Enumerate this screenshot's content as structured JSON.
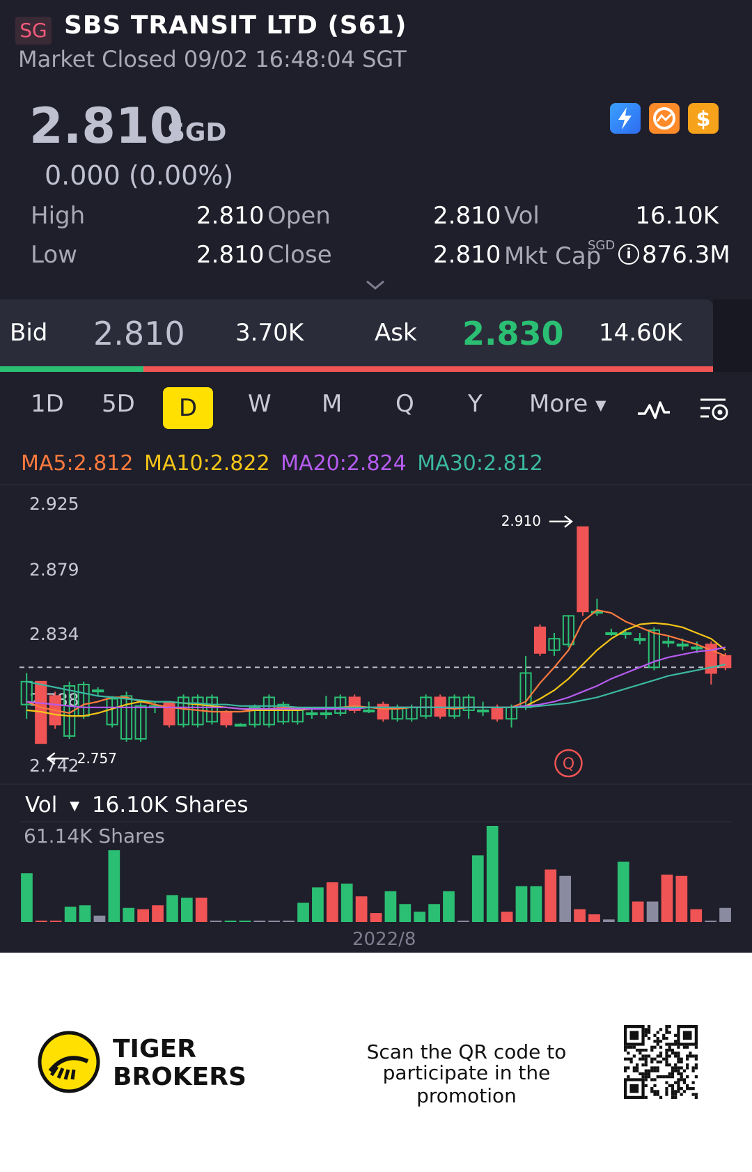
{
  "header": {
    "market_tag": "SG",
    "title": "SBS TRANSIT LTD (S61)",
    "status": "Market Closed 09/02 16:48:04 SGT"
  },
  "quote": {
    "price": "2.810",
    "currency": "SGD",
    "change": "0.000 (0.00%)",
    "stats": {
      "high_label": "High",
      "high_value": "2.810",
      "low_label": "Low",
      "low_value": "2.810",
      "open_label": "Open",
      "open_value": "2.810",
      "close_label": "Close",
      "close_value": "2.810",
      "vol_label": "Vol",
      "vol_value": "16.10K",
      "mktcap_label": "Mkt Cap",
      "mktcap_currency": "SGD",
      "mktcap_value": "876.3M"
    }
  },
  "orderbook": {
    "bid_label": "Bid",
    "bid_price": "2.810",
    "bid_size": "3.70K",
    "ask_label": "Ask",
    "ask_price": "2.830",
    "ask_size": "14.60K"
  },
  "timeframes": [
    "1D",
    "5D",
    "D",
    "W",
    "M",
    "Q",
    "Y"
  ],
  "selected_timeframe": "D",
  "more_label": "More",
  "icons": {
    "indicator": "line-indicator-icon",
    "settings": "chart-settings-icon",
    "badges": [
      "lightning-icon",
      "chart-badge-icon",
      "dollar-icon"
    ]
  },
  "ma": {
    "ma5": "MA5:2.812",
    "ma10": "MA10:2.822",
    "ma20": "MA20:2.824",
    "ma30": "MA30:2.812"
  },
  "colors": {
    "background": "#1f1f2b",
    "up": "#2bbf73",
    "down": "#f05454",
    "neutral": "#8a8aa0",
    "ma5": "#ff7a3d",
    "ma10": "#f5c518",
    "ma20": "#b65cf0",
    "ma30": "#3bb8a0",
    "selected_tab": "#ffe000"
  },
  "chart_data": {
    "type": "candlestick",
    "y_ticks": [
      "2.925",
      "2.879",
      "2.834",
      "2.788",
      "2.742"
    ],
    "ylim": [
      2.742,
      2.925
    ],
    "high_marker": "2.910",
    "low_marker": "2.757",
    "event_marker": "Q",
    "x_label": "2022/8",
    "candles": [
      {
        "o": 2.784,
        "c": 2.8,
        "h": 2.806,
        "l": 2.774
      },
      {
        "o": 2.8,
        "c": 2.757,
        "h": 2.8,
        "l": 2.757
      },
      {
        "o": 2.79,
        "c": 2.77,
        "h": 2.793,
        "l": 2.767
      },
      {
        "o": 2.762,
        "c": 2.797,
        "h": 2.8,
        "l": 2.76
      },
      {
        "o": 2.776,
        "c": 2.798,
        "h": 2.8,
        "l": 2.774
      },
      {
        "o": 2.794,
        "c": 2.794,
        "h": 2.796,
        "l": 2.79
      },
      {
        "o": 2.77,
        "c": 2.788,
        "h": 2.79,
        "l": 2.768
      },
      {
        "o": 2.76,
        "c": 2.79,
        "h": 2.793,
        "l": 2.758
      },
      {
        "o": 2.76,
        "c": 2.783,
        "h": 2.785,
        "l": 2.758
      },
      {
        "o": 2.783,
        "c": 2.783,
        "h": 2.786,
        "l": 2.778
      },
      {
        "o": 2.785,
        "c": 2.77,
        "h": 2.786,
        "l": 2.768
      },
      {
        "o": 2.77,
        "c": 2.789,
        "h": 2.791,
        "l": 2.768
      },
      {
        "o": 2.77,
        "c": 2.789,
        "h": 2.791,
        "l": 2.768
      },
      {
        "o": 2.772,
        "c": 2.789,
        "h": 2.791,
        "l": 2.77
      },
      {
        "o": 2.778,
        "c": 2.77,
        "h": 2.78,
        "l": 2.768
      },
      {
        "o": 2.77,
        "c": 2.77,
        "h": 2.771,
        "l": 2.769
      },
      {
        "o": 2.77,
        "c": 2.782,
        "h": 2.784,
        "l": 2.768
      },
      {
        "o": 2.77,
        "c": 2.789,
        "h": 2.791,
        "l": 2.768
      },
      {
        "o": 2.772,
        "c": 2.784,
        "h": 2.786,
        "l": 2.77
      },
      {
        "o": 2.772,
        "c": 2.78,
        "h": 2.782,
        "l": 2.77
      },
      {
        "o": 2.778,
        "c": 2.778,
        "h": 2.781,
        "l": 2.774
      },
      {
        "o": 2.778,
        "c": 2.778,
        "h": 2.79,
        "l": 2.774
      },
      {
        "o": 2.778,
        "c": 2.789,
        "h": 2.791,
        "l": 2.776
      },
      {
        "o": 2.789,
        "c": 2.78,
        "h": 2.791,
        "l": 2.778
      },
      {
        "o": 2.78,
        "c": 2.78,
        "h": 2.786,
        "l": 2.778
      },
      {
        "o": 2.784,
        "c": 2.774,
        "h": 2.786,
        "l": 2.772
      },
      {
        "o": 2.774,
        "c": 2.782,
        "h": 2.784,
        "l": 2.772
      },
      {
        "o": 2.774,
        "c": 2.782,
        "h": 2.784,
        "l": 2.772
      },
      {
        "o": 2.776,
        "c": 2.789,
        "h": 2.791,
        "l": 2.774
      },
      {
        "o": 2.789,
        "c": 2.776,
        "h": 2.791,
        "l": 2.774
      },
      {
        "o": 2.776,
        "c": 2.789,
        "h": 2.791,
        "l": 2.774
      },
      {
        "o": 2.78,
        "c": 2.789,
        "h": 2.791,
        "l": 2.774
      },
      {
        "o": 2.78,
        "c": 2.78,
        "h": 2.786,
        "l": 2.776
      },
      {
        "o": 2.782,
        "c": 2.774,
        "h": 2.784,
        "l": 2.772
      },
      {
        "o": 2.774,
        "c": 2.782,
        "h": 2.784,
        "l": 2.768
      },
      {
        "o": 2.782,
        "c": 2.806,
        "h": 2.818,
        "l": 2.78
      },
      {
        "o": 2.838,
        "c": 2.82,
        "h": 2.84,
        "l": 2.818
      },
      {
        "o": 2.822,
        "c": 2.83,
        "h": 2.834,
        "l": 2.818
      },
      {
        "o": 2.826,
        "c": 2.846,
        "h": 2.846,
        "l": 2.824
      },
      {
        "o": 2.908,
        "c": 2.849,
        "h": 2.908,
        "l": 2.846
      },
      {
        "o": 2.849,
        "c": 2.849,
        "h": 2.858,
        "l": 2.846
      },
      {
        "o": 2.834,
        "c": 2.834,
        "h": 2.837,
        "l": 2.832
      },
      {
        "o": 2.834,
        "c": 2.834,
        "h": 2.837,
        "l": 2.83
      },
      {
        "o": 2.83,
        "c": 2.83,
        "h": 2.834,
        "l": 2.826
      },
      {
        "o": 2.81,
        "c": 2.836,
        "h": 2.838,
        "l": 2.808
      },
      {
        "o": 2.828,
        "c": 2.828,
        "h": 2.832,
        "l": 2.824
      },
      {
        "o": 2.826,
        "c": 2.826,
        "h": 2.83,
        "l": 2.822
      },
      {
        "o": 2.824,
        "c": 2.824,
        "h": 2.828,
        "l": 2.82
      },
      {
        "o": 2.826,
        "c": 2.806,
        "h": 2.828,
        "l": 2.798
      },
      {
        "o": 2.818,
        "c": 2.81,
        "h": 2.82,
        "l": 2.808
      }
    ],
    "ma5": [
      2.786,
      2.782,
      2.78,
      2.778,
      2.784,
      2.786,
      2.789,
      2.789,
      2.786,
      2.784,
      2.782,
      2.781,
      2.78,
      2.779,
      2.779,
      2.779,
      2.78,
      2.781,
      2.782,
      2.782,
      2.781,
      2.781,
      2.782,
      2.783,
      2.782,
      2.781,
      2.781,
      2.782,
      2.782,
      2.782,
      2.781,
      2.782,
      2.782,
      2.782,
      2.782,
      2.786,
      2.799,
      2.81,
      2.822,
      2.842,
      2.85,
      2.848,
      2.842,
      2.838,
      2.834,
      2.832,
      2.829,
      2.826,
      2.822,
      2.818
    ],
    "ma10": [
      2.78,
      2.779,
      2.777,
      2.776,
      2.776,
      2.778,
      2.781,
      2.784,
      2.786,
      2.786,
      2.786,
      2.785,
      2.784,
      2.783,
      2.782,
      2.781,
      2.78,
      2.78,
      2.78,
      2.78,
      2.781,
      2.781,
      2.781,
      2.782,
      2.782,
      2.782,
      2.782,
      2.782,
      2.782,
      2.782,
      2.782,
      2.782,
      2.782,
      2.782,
      2.782,
      2.783,
      2.788,
      2.794,
      2.802,
      2.812,
      2.822,
      2.83,
      2.836,
      2.84,
      2.841,
      2.84,
      2.838,
      2.834,
      2.83,
      2.822
    ],
    "ma20": [
      2.786,
      2.785,
      2.784,
      2.783,
      2.782,
      2.782,
      2.782,
      2.782,
      2.782,
      2.782,
      2.782,
      2.782,
      2.782,
      2.782,
      2.782,
      2.781,
      2.781,
      2.781,
      2.781,
      2.781,
      2.781,
      2.781,
      2.781,
      2.781,
      2.782,
      2.782,
      2.782,
      2.782,
      2.782,
      2.782,
      2.782,
      2.782,
      2.782,
      2.782,
      2.782,
      2.783,
      2.784,
      2.786,
      2.789,
      2.793,
      2.797,
      2.802,
      2.806,
      2.81,
      2.814,
      2.817,
      2.819,
      2.821,
      2.822,
      2.824
    ],
    "ma30": [
      2.8,
      2.798,
      2.796,
      2.794,
      2.792,
      2.79,
      2.789,
      2.788,
      2.787,
      2.786,
      2.786,
      2.785,
      2.785,
      2.784,
      2.784,
      2.783,
      2.783,
      2.783,
      2.783,
      2.782,
      2.782,
      2.782,
      2.782,
      2.782,
      2.782,
      2.782,
      2.782,
      2.782,
      2.782,
      2.782,
      2.782,
      2.782,
      2.782,
      2.782,
      2.782,
      2.782,
      2.783,
      2.784,
      2.785,
      2.787,
      2.789,
      2.792,
      2.795,
      2.798,
      2.801,
      2.804,
      2.806,
      2.808,
      2.81,
      2.812
    ]
  },
  "volume": {
    "label": "Vol",
    "value": "16.10K Shares",
    "max_label": "61.14K Shares",
    "values": [
      38,
      1,
      1,
      12,
      13,
      5,
      56,
      11,
      10,
      13,
      21,
      19,
      19,
      0,
      1,
      1,
      1,
      0,
      1,
      15,
      27,
      31,
      30,
      20,
      7,
      24,
      14,
      8,
      14,
      24,
      0,
      52,
      75,
      8,
      28,
      28,
      41,
      36,
      10,
      6,
      2,
      47,
      16,
      16,
      37,
      36,
      10,
      0,
      11
    ],
    "directions": [
      "up",
      "down",
      "down",
      "up",
      "up",
      "neutral",
      "up",
      "up",
      "down",
      "down",
      "up",
      "up",
      "down",
      "neutral",
      "up",
      "up",
      "neutral",
      "neutral",
      "neutral",
      "up",
      "up",
      "down",
      "up",
      "down",
      "down",
      "up",
      "up",
      "up",
      "up",
      "up",
      "neutral",
      "up",
      "up",
      "down",
      "up",
      "up",
      "down",
      "neutral",
      "down",
      "down",
      "neutral",
      "up",
      "down",
      "neutral",
      "down",
      "down",
      "down",
      "neutral",
      "neutral"
    ]
  },
  "promo": {
    "brand_line1": "TIGER",
    "brand_line2": "BROKERS",
    "text_line1": "Scan the QR code to",
    "text_line2": "participate in the promotion"
  }
}
